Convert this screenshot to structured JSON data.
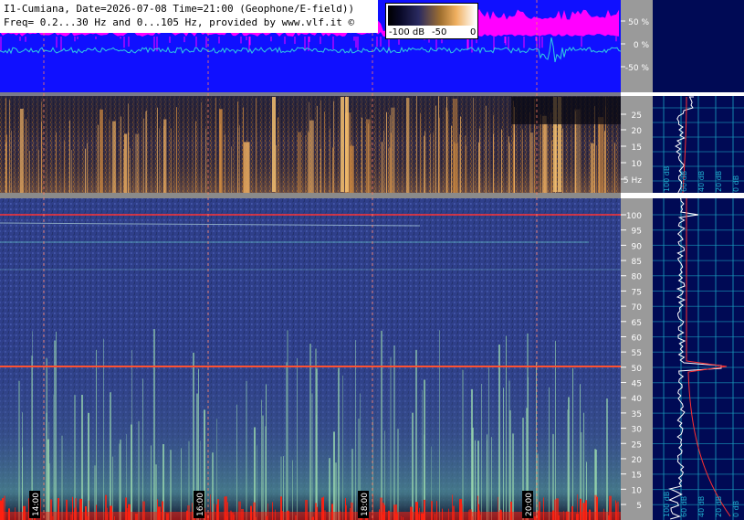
{
  "header": {
    "title_line_1": "I1-Cumiana, Date=2026-07-08 Time=21:00 (Geophone/E-field))",
    "title_line_2": "Freq= 0.2...30 Hz and 0...105 Hz, provided by www.vlf.it ©"
  },
  "color_scale": {
    "labels": [
      "-100 dB",
      "-50",
      "0"
    ]
  },
  "amplitude_axis": {
    "ticks": [
      "50 %",
      "0 %",
      "-50 %"
    ]
  },
  "low_freq_axis": {
    "ticks": [
      "25",
      "20",
      "15",
      "10",
      "5 Hz"
    ]
  },
  "high_freq_axis": {
    "ticks": [
      "100",
      "95",
      "90",
      "85",
      "80",
      "75",
      "70",
      "65",
      "60",
      "55",
      "50",
      "45",
      "40",
      "35",
      "30",
      "25",
      "20",
      "15",
      "10",
      "5"
    ]
  },
  "time_axis": {
    "ticks": [
      "14:00",
      "16:00",
      "18:00",
      "20:00"
    ]
  },
  "side_panel_upper": {
    "db_labels": [
      "100 dB",
      "60 dB",
      "40 dB",
      "20 dB",
      "0 dB"
    ]
  },
  "side_panel_lower": {
    "db_labels": [
      "100 dB",
      "60 dB",
      "40 dB",
      "20 dB",
      "0 dB"
    ]
  },
  "colors": {
    "waveform_bg": "#1010ff",
    "magenta": "#ff00ff",
    "cyan_trace": "#30d0e0",
    "axis_gray": "#9a9a9a",
    "side_panel_bg": "#000a55",
    "line_50hz": "#ff3030"
  }
}
